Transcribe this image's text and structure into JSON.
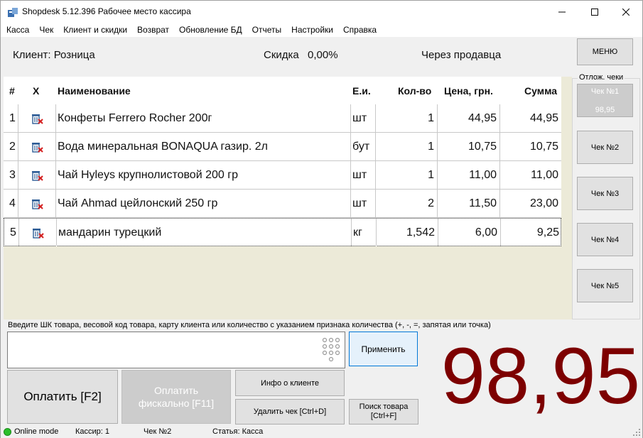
{
  "window": {
    "title": "Shopdesk 5.12.396 Рабочее место кассира",
    "minimize": "—",
    "maximize": "☐",
    "close": "✕"
  },
  "menu": [
    "Касса",
    "Чек",
    "Клиент и скидки",
    "Возврат",
    "Обновление БД",
    "Отчеты",
    "Настройки",
    "Справка"
  ],
  "info": {
    "client": "Клиент: Розница",
    "discount_label": "Скидка",
    "discount_value": "0,00%",
    "mode": "Через продавца"
  },
  "right_panel": {
    "menu_button": "МЕНЮ",
    "deferred_label": "Отлож. чеки",
    "checks": [
      {
        "label": "Чек №1",
        "amount": "98,95",
        "active": true
      },
      {
        "label": "Чек №2",
        "amount": ""
      },
      {
        "label": "Чек №3",
        "amount": ""
      },
      {
        "label": "Чек №4",
        "amount": ""
      },
      {
        "label": "Чек №5",
        "amount": ""
      }
    ]
  },
  "table": {
    "headers": {
      "num": "#",
      "x": "X",
      "name": "Наименование",
      "unit": "Е.и.",
      "qty": "Кол-во",
      "price": "Цена, грн.",
      "sum": "Сумма"
    },
    "rows": [
      {
        "num": "1",
        "name": "Конфеты Ferrero Rocher 200г",
        "unit": "шт",
        "qty": "1",
        "price": "44,95",
        "sum": "44,95"
      },
      {
        "num": "2",
        "name": "Вода минеральная BONAQUA газир. 2л",
        "unit": "бут",
        "qty": "1",
        "price": "10,75",
        "sum": "10,75"
      },
      {
        "num": "3",
        "name": "Чай Hyleys крупнолистовой 200 гр",
        "unit": "шт",
        "qty": "1",
        "price": "11,00",
        "sum": "11,00"
      },
      {
        "num": "4",
        "name": "Чай Ahmad цейлонский 250 гр",
        "unit": "шт",
        "qty": "2",
        "price": "11,50",
        "sum": "23,00"
      },
      {
        "num": "5",
        "name": "мандарин турецкий",
        "unit": "кг",
        "qty": "1,542",
        "price": "6,00",
        "sum": "9,25"
      }
    ]
  },
  "input": {
    "hint": "Введите ШК товара, весовой код товара,  карту клиента или количество с указанием признака количества (+, -, =, запятая или точка)",
    "value": "",
    "apply": "Применить"
  },
  "buttons": {
    "pay": "Оплатить [F2]",
    "pay_fiscal_line1": "Оплатить",
    "pay_fiscal_line2": "фискально [F11]",
    "client_info": "Инфо о клиенте",
    "delete_check": "Удалить чек [Ctrl+D]",
    "search_line1": "Поиск товара",
    "search_line2": "[Ctrl+F]"
  },
  "total": "98,95",
  "status": {
    "online": "Online mode",
    "cashier": "Кассир: 1",
    "check": "Чек №2",
    "article": "Статья: Касса"
  },
  "colors": {
    "total": "#7d0000",
    "online": "#2bbf2b",
    "accent": "#0078d7"
  }
}
